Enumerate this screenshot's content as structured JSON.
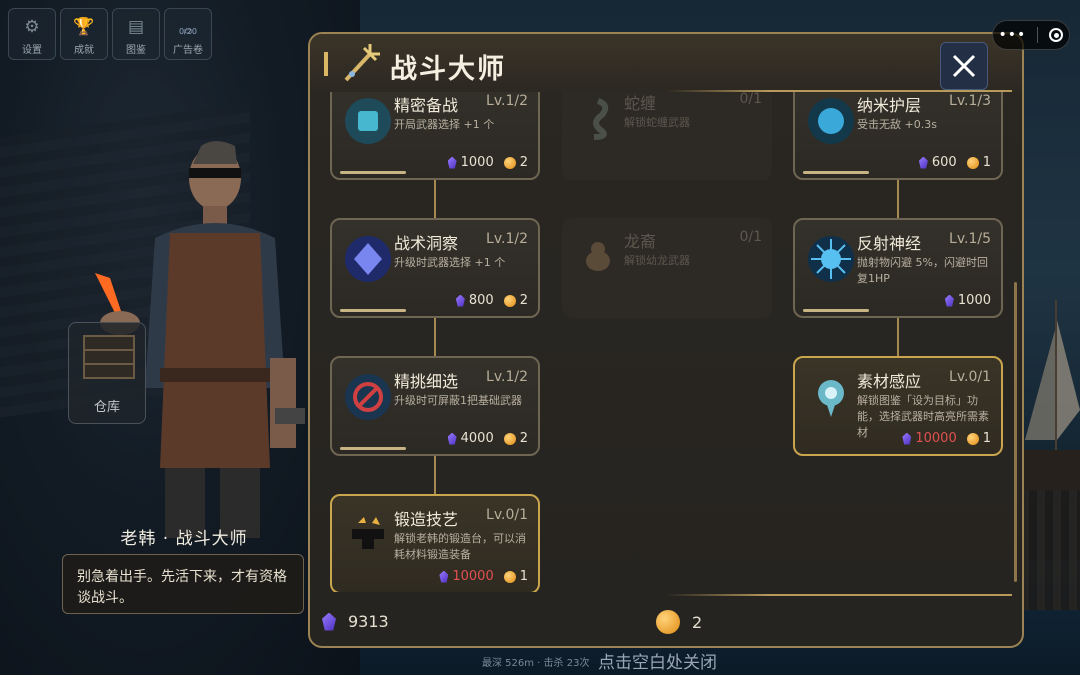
{
  "top_menu": [
    {
      "label": "设置",
      "icon": "gear-icon"
    },
    {
      "label": "成就",
      "icon": "trophy-icon"
    },
    {
      "label": "图鉴",
      "icon": "book-icon"
    },
    {
      "label": "广告卷",
      "icon": "ticket-icon",
      "sub": "0/20"
    }
  ],
  "npc": {
    "warehouse_label": "仓库",
    "name": "老韩 · 战斗大师",
    "speech": "别急着出手。先活下来，才有资格谈战斗。"
  },
  "panel": {
    "title": "战斗大师",
    "skills": [
      {
        "name": "精密备战",
        "level": "Lv.1/2",
        "desc": "开局武器选择 +1 个",
        "gem": "1000",
        "coin": "2",
        "icon": "cards-icon",
        "state": "normal"
      },
      {
        "name": "战术洞察",
        "level": "Lv.1/2",
        "desc": "升级时武器选择 +1 个",
        "gem": "800",
        "coin": "2",
        "icon": "crystal-icon",
        "state": "normal"
      },
      {
        "name": "精挑细选",
        "level": "Lv.1/2",
        "desc": "升级时可屏蔽1把基础武器",
        "gem": "4000",
        "coin": "2",
        "icon": "ban-icon",
        "state": "normal"
      },
      {
        "name": "锻造技艺",
        "level": "Lv.0/1",
        "desc": "解锁老韩的锻造台，可以消耗材料锻造装备",
        "gem": "10000",
        "coin": "1",
        "icon": "anvil-icon",
        "state": "highlight"
      },
      {
        "name": "蛇缠",
        "level": "0/1",
        "desc": "解锁蛇缠武器",
        "icon": "snake-icon",
        "state": "locked"
      },
      {
        "name": "龙裔",
        "level": "0/1",
        "desc": "解锁幼龙武器",
        "icon": "dragon-icon",
        "state": "locked"
      },
      {
        "name": "纳米护层",
        "level": "Lv.1/3",
        "desc": "受击无敌 +0.3s",
        "gem": "600",
        "coin": "1",
        "icon": "nano-shield-icon",
        "state": "normal"
      },
      {
        "name": "反射神经",
        "level": "Lv.1/5",
        "desc": "抛射物闪避 5%，闪避时回复1HP",
        "gem": "1000",
        "icon": "reflex-icon",
        "state": "normal"
      },
      {
        "name": "素材感应",
        "level": "Lv.0/1",
        "desc": "解锁图鉴「设为目标」功能，选择武器时高亮所需素材",
        "gem": "10000",
        "coin": "1",
        "icon": "material-sense-icon",
        "state": "highlight"
      }
    ],
    "currency": {
      "gems": "9313",
      "coins": "2"
    }
  },
  "bottom": {
    "depth": "最深 526m · 击杀 23次",
    "hint": "点击空白处关闭"
  },
  "colors": {
    "accent_gold": "#c9a64e",
    "cost_red": "#e05050",
    "panel_bg": "#2a2723"
  }
}
